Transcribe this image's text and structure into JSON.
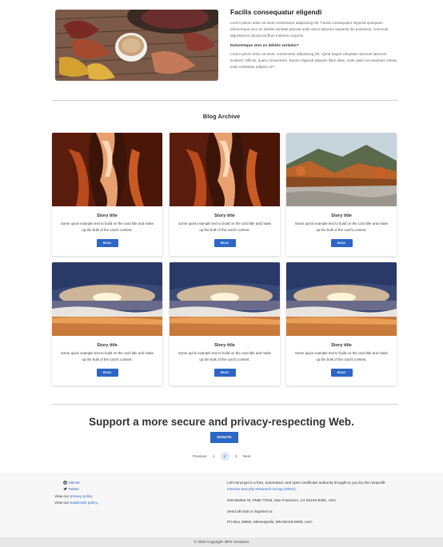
{
  "feature": {
    "title": "Facilis consequatur eligendi",
    "paragraph1": "Lorem ipsum dolor sit amet consectetur adipisicing elit. Facilis consequatur eligendi quisquam doloremque vero ex debitis veritatis placeat unde animi laborum sapiente illo possimus, commodi dignissimos obcaecati illum maiores corporis.",
    "subtitle": "Doloremque vero ex debitis veritatis?",
    "paragraph2": "Lorem ipsum dolor sit amet, consectetur adipisicing elit. Quod itaque voluptate nesciunt laborum incidunt. Officiis, quam consectetur. Earum eligendi aliquam illum alias, unde optio accusantium soluta, iusto molestiae adipisci et?"
  },
  "archive": {
    "title": "Blog Archive",
    "cards": [
      {
        "title": "Story title",
        "text": "Some quick example text to build on the card title and make up the bulk of the card's content.",
        "button": "READ",
        "image": "canyon"
      },
      {
        "title": "Story title",
        "text": "Some quick example text to build on the card title and make up the bulk of the card's content.",
        "button": "READ",
        "image": "canyon"
      },
      {
        "title": "Story title",
        "text": "Some quick example text to build on the card title and make up the bulk of the card's content.",
        "button": "READ",
        "image": "mountain-river"
      },
      {
        "title": "Story title",
        "text": "Some quick example text to build on the card title and make up the bulk of the card's content.",
        "button": "READ",
        "image": "beach-sunset"
      },
      {
        "title": "Story title",
        "text": "Some quick example text to build on the card title and make up the bulk of the card's content.",
        "button": "READ",
        "image": "beach-sunset"
      },
      {
        "title": "Story title",
        "text": "Some quick example text to build on the card title and make up the bulk of the card's content.",
        "button": "READ",
        "image": "beach-sunset"
      }
    ]
  },
  "support": {
    "title": "Support a more secure and privacy-respecting Web.",
    "donate": "DONATE"
  },
  "pagination": {
    "previous": "Previous",
    "pages": [
      "1",
      "2",
      "3"
    ],
    "active": "2",
    "next": "Next"
  },
  "footer": {
    "github": "GitHub",
    "twitter": "Twitter",
    "privacy_prefix": "View our ",
    "privacy_link": "privacy policy",
    "privacy_suffix": ".",
    "trademark_prefix": "View our ",
    "trademark_link": "trademark policy",
    "trademark_suffix": ".",
    "about_prefix": "Let's Encrypt is a free, automated, and open certificate authority brought to you by the nonprofit ",
    "about_link": "Internet Security Research Group (ISRG)",
    "about_suffix": ".",
    "address1": "548 Market St, PMB 77519, San Francisco, CA 94104-5401, USA",
    "mail_label": "Send all mail or inquiries to:",
    "address2": "PO Box 18666, Minneapolis, MN 55418-0666, USA",
    "copyright": "© 2022 Copyright: BPS Creations"
  },
  "colors": {
    "accent": "#2c66c7",
    "footer_bg": "#f7f7f7",
    "copyright_bg": "#e7e7e7"
  }
}
